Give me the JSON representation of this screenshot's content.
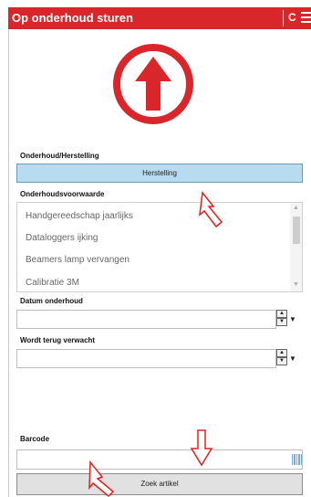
{
  "titlebar": {
    "title": "Op onderhoud sturen",
    "refresh_label": "C",
    "menu_icon": "hamburger-icon"
  },
  "colors": {
    "accent": "#d9262b",
    "selected": "#b7dcef"
  },
  "onderhoud": {
    "label": "Onderhoud/Herstelling",
    "selected_value": "Herstelling"
  },
  "voorwaarde": {
    "label": "Onderhoudsvoorwaarde",
    "items": [
      "Handgereedschap jaarlijks",
      "Dataloggers ijking",
      "Beamers lamp vervangen",
      "Calibratie 3M"
    ]
  },
  "datum": {
    "label": "Datum onderhoud",
    "value": ""
  },
  "terug": {
    "label": "Wordt terug verwacht",
    "value": ""
  },
  "barcode": {
    "label": "Barcode",
    "value": "",
    "icon": "barcode-icon"
  },
  "zoek_button": "Zoek artikel"
}
